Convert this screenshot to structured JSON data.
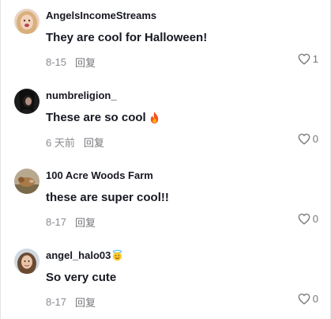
{
  "comments": [
    {
      "username": "AngelsIncomeStreams",
      "text": "They are cool for Halloween!",
      "date": "8-15",
      "reply_label": "回复",
      "likes": "1",
      "avatar": "avatar-blonde-woman"
    },
    {
      "username": "numbreligion_",
      "text": "These are so cool",
      "text_emoji": "fire",
      "date": "6 天前",
      "reply_label": "回复",
      "likes": "0",
      "avatar": "avatar-dark-hair"
    },
    {
      "username": "100 Acre Woods Farm",
      "text": "these are super cool!!",
      "date": "8-17",
      "reply_label": "回复",
      "likes": "0",
      "avatar": "avatar-farm-animal"
    },
    {
      "username": "angel_halo03",
      "username_emoji": "halo-smile",
      "text": "So very cute",
      "date": "8-17",
      "reply_label": "回复",
      "likes": "0",
      "avatar": "avatar-brown-hair-woman"
    }
  ],
  "colors": {
    "text": "#161823",
    "meta": "#8a8b91",
    "icon": "#75767b"
  }
}
